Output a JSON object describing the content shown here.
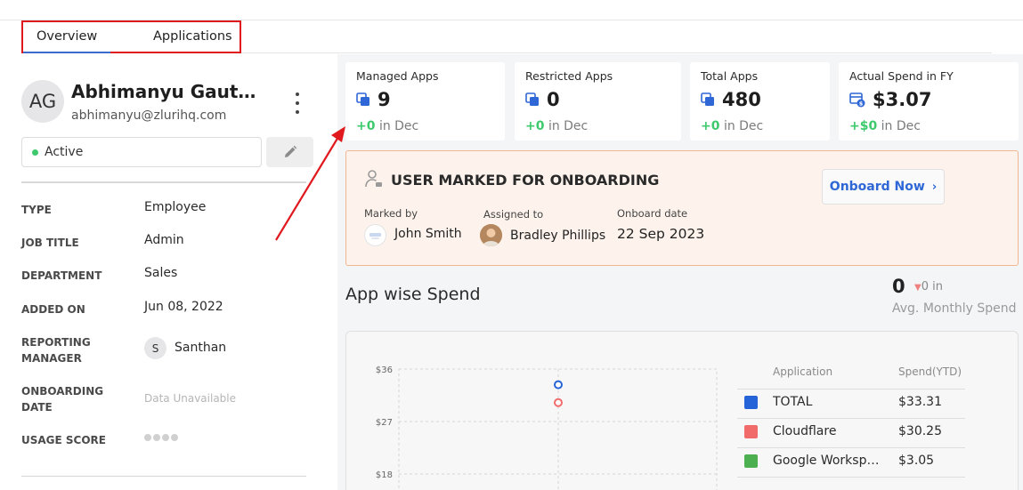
{
  "tabs": [
    {
      "label": "Overview"
    },
    {
      "label": "Applications"
    }
  ],
  "user": {
    "initials": "AG",
    "name": "Abhimanyu Gautam",
    "email": "abhimanyu@zlurihq.com",
    "status": "Active",
    "status_color": "#3ec96d"
  },
  "details": {
    "type": {
      "label": "TYPE",
      "value": "Employee"
    },
    "job_title": {
      "label": "JOB TITLE",
      "value": "Admin"
    },
    "department": {
      "label": "DEPARTMENT",
      "value": "Sales"
    },
    "added_on": {
      "label": "ADDED ON",
      "value": "Jun 08, 2022"
    },
    "reporting_manager": {
      "label": "REPORTING MANAGER",
      "initial": "S",
      "value": "Santhan"
    },
    "onboarding_date": {
      "label": "ONBOARDING DATE",
      "value": "Data Unavailable"
    },
    "usage_score": {
      "label": "USAGE SCORE"
    }
  },
  "stats": [
    {
      "title": "Managed Apps",
      "value": "9",
      "delta": "+0",
      "period": "in Dec",
      "icon": "apps-icon"
    },
    {
      "title": "Restricted Apps",
      "value": "0",
      "delta": "+0",
      "period": "in Dec",
      "icon": "apps-icon"
    },
    {
      "title": "Total Apps",
      "value": "480",
      "delta": "+0",
      "period": "in Dec",
      "icon": "apps-icon"
    },
    {
      "title": "Actual Spend in FY",
      "value": "$3.07",
      "delta": "+$0",
      "period": "in Dec",
      "icon": "spend-icon"
    }
  ],
  "onboarding": {
    "title": "USER MARKED FOR ONBOARDING",
    "button": "Onboard Now",
    "marked_by_label": "Marked by",
    "marked_by": "John Smith",
    "assigned_to_label": "Assigned to",
    "assigned_to": "Bradley Phillips",
    "onboard_date_label": "Onboard date",
    "onboard_date": "22 Sep 2023"
  },
  "app_spend": {
    "title": "App wise Spend",
    "avg_value": "0",
    "avg_delta": "0",
    "avg_delta_suffix": "in",
    "avg_label": "Avg. Monthly Spend",
    "table_headers": {
      "application": "Application",
      "spend": "Spend(YTD)"
    },
    "rows": [
      {
        "app": "TOTAL",
        "spend": "$33.31",
        "color": "#2463d8"
      },
      {
        "app": "Cloudflare",
        "spend": "$30.25",
        "color": "#f26b6b"
      },
      {
        "app": "Google Workspace",
        "spend": "$3.05",
        "color": "#4caf50"
      }
    ]
  },
  "chart_data": {
    "type": "scatter",
    "y_ticks": [
      "$36",
      "$27",
      "$18"
    ],
    "ylim": [
      18,
      36
    ],
    "grid": true,
    "series": [
      {
        "name": "TOTAL",
        "color": "#2463d8",
        "y": [
          33.31
        ]
      },
      {
        "name": "Cloudflare",
        "color": "#f26b6b",
        "y": [
          30.25
        ]
      }
    ]
  }
}
